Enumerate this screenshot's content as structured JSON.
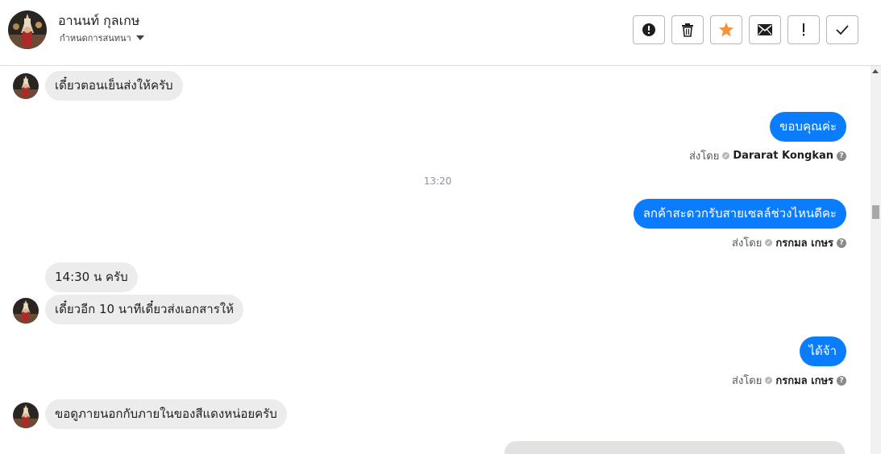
{
  "header": {
    "contact_name": "อานนท์ กุลเกษ",
    "assign_label": "กำหนดการสนทนา",
    "actions": [
      {
        "name": "mark-spam",
        "icon": "exclamation-circle-icon"
      },
      {
        "name": "delete",
        "icon": "trash-icon"
      },
      {
        "name": "star",
        "icon": "star-icon",
        "color": "#f7923a"
      },
      {
        "name": "mark-unread",
        "icon": "envelope-icon"
      },
      {
        "name": "follow-up",
        "icon": "exclamation-icon"
      },
      {
        "name": "mark-done",
        "icon": "checkmark-icon"
      }
    ]
  },
  "messages": {
    "m1": "เดี๋ยวตอนเย็นส่งให้ครับ",
    "m2": "ขอบคุณค่ะ",
    "m2_sent_by_label": "ส่งโดย",
    "m2_sender": "Dararat Kongkan",
    "timestamp": "13:20",
    "m3": "ลกค้าสะดวกรับสายเซลล์ช่วงไหนดีคะ",
    "m3_sent_by_label": "ส่งโดย",
    "m3_sender": "กรกมล เกษร",
    "m4": "14:30 น ครับ",
    "m5": "เดี๋ยวอีก 10 นาทีเดี๋ยวส่งเอกสารให้",
    "m6": "ได้จ้า",
    "m6_sent_by_label": "ส่งโดย",
    "m6_sender": "กรกมล เกษร",
    "m7": "ขอดูภายนอกกับภายในของสีแดงหน่อยครับ"
  },
  "colors": {
    "outgoing_bubble": "#0a7cff",
    "incoming_bubble": "#ececec",
    "star": "#f7923a"
  }
}
